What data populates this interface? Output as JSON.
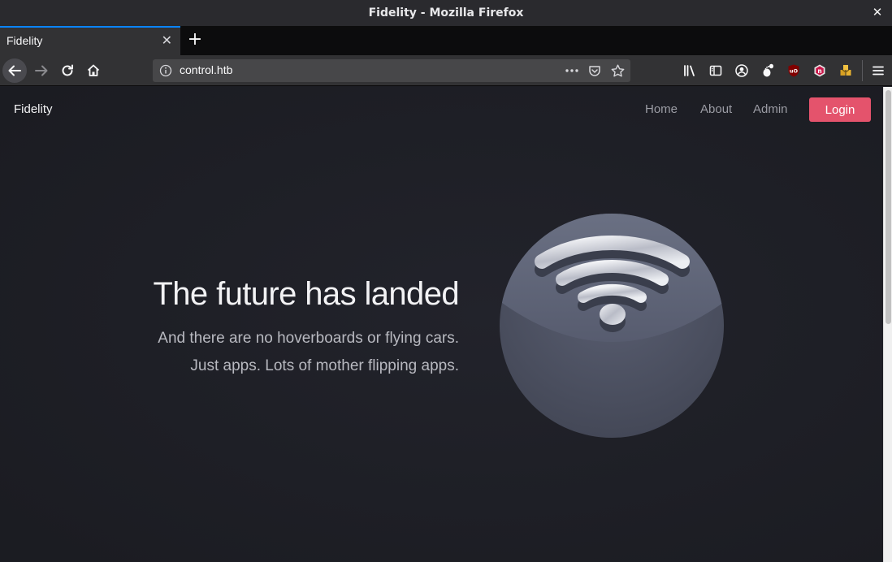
{
  "window": {
    "title": "Fidelity - Mozilla Firefox"
  },
  "tabs": [
    {
      "title": "Fidelity"
    }
  ],
  "url": "control.htb",
  "site": {
    "brand": "Fidelity",
    "nav": [
      "Home",
      "About",
      "Admin"
    ],
    "login_label": "Login",
    "hero_title": "The future has landed",
    "hero_lines": [
      "And there are no hoverboards or flying cars.",
      "Just apps. Lots of mother flipping apps."
    ]
  },
  "colors": {
    "accent": "#e4536c",
    "page_bg": "#1d1e25",
    "tab_highlight": "#0a84ff"
  },
  "icons": {
    "toolbar": [
      "library-icon",
      "sidebar-icon",
      "account-icon",
      "gnome-icon",
      "ublock-icon",
      "noscript-icon",
      "extension-icon",
      "menu-icon"
    ],
    "hero": "wifi-icon"
  }
}
